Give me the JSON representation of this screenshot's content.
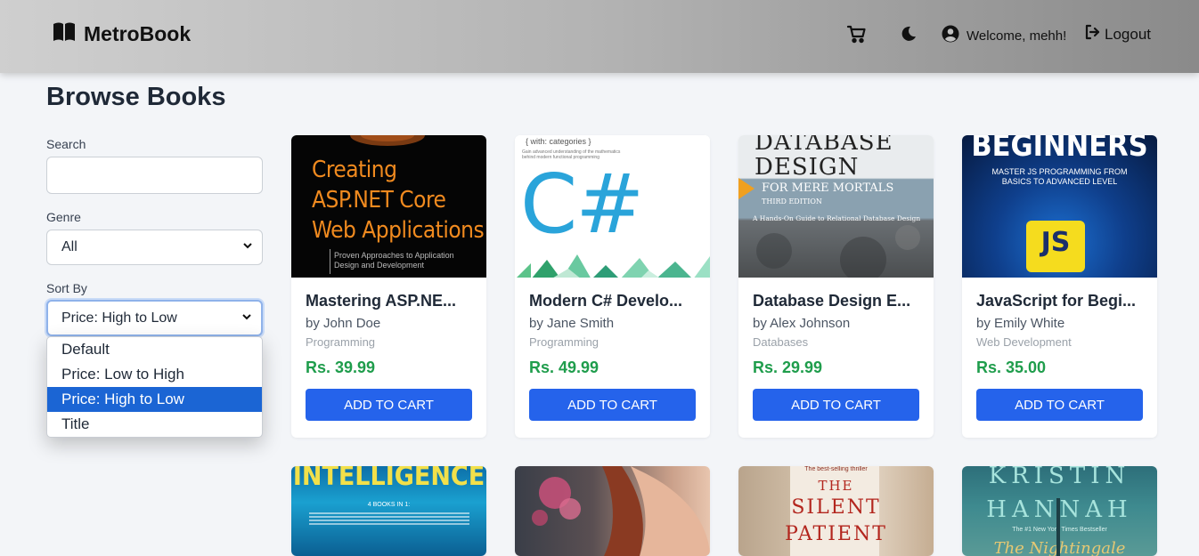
{
  "navbar": {
    "brand": "MetroBook",
    "welcome": "Welcome, mehh!",
    "logout": "Logout",
    "icons": [
      "book-icon",
      "cart-icon",
      "moon-icon",
      "user-circle-icon",
      "logout-icon"
    ]
  },
  "page": {
    "title": "Browse Books"
  },
  "filters": {
    "search_label": "Search",
    "search_value": "",
    "genre_label": "Genre",
    "genre_value": "All",
    "sort_label": "Sort By",
    "sort_value": "Price: High to Low",
    "sort_options": [
      "Default",
      "Price: Low to High",
      "Price: High to Low",
      "Title"
    ]
  },
  "books": [
    {
      "title": "Mastering ASP.NE...",
      "author": "by John Doe",
      "genre": "Programming",
      "price": "Rs. 39.99",
      "button": "ADD TO CART",
      "cover": {
        "lines": [
          "Creating",
          "ASP.NET Core",
          "Web Applications"
        ],
        "sub": [
          "Proven Approaches to Application",
          "Design and Development"
        ]
      }
    },
    {
      "title": "Modern C# Develo...",
      "author": "by Jane Smith",
      "genre": "Programming",
      "price": "Rs. 49.99",
      "button": "ADD TO CART",
      "cover": {
        "top": "{ with: categories }",
        "sub": [
          "Gain advanced understanding of the mathematics",
          "behind modern functional programming"
        ],
        "big": "C#"
      }
    },
    {
      "title": "Database Design E...",
      "author": "by Alex Johnson",
      "genre": "Databases",
      "price": "Rs. 29.99",
      "button": "ADD TO CART",
      "cover": {
        "lines": [
          "DATABASE",
          "DESIGN"
        ],
        "band": "FOR MERE MORTALS",
        "edition": "THIRD EDITION",
        "sub": "A Hands-On Guide to Relational Database Design"
      }
    },
    {
      "title": "JavaScript for Begi...",
      "author": "by Emily White",
      "genre": "Web Development",
      "price": "Rs. 35.00",
      "button": "ADD TO CART",
      "cover": {
        "lines": [
          "BEGINNERS"
        ],
        "sub": [
          "MASTER JS PROGRAMMING FROM",
          "BASICS TO ADVANCED LEVEL"
        ],
        "big": "JS"
      }
    }
  ],
  "covers_row2": [
    {
      "lines": [
        "INTELLIGENCE"
      ],
      "sub": [
        "4 BOOKS IN 1:"
      ]
    },
    {
      "lines": []
    },
    {
      "top": "The best-selling thriller",
      "lines": [
        "THE",
        "SILENT",
        "PATIENT"
      ]
    },
    {
      "lines": [
        "KRISTIN",
        "HANNAH"
      ],
      "sub": [
        "The #1 New York Times Bestseller"
      ],
      "script": "The Nightingale"
    }
  ],
  "colors": {
    "primary": "#2563eb",
    "price": "#1f9d4c",
    "selected_option": "#1b65d4"
  }
}
